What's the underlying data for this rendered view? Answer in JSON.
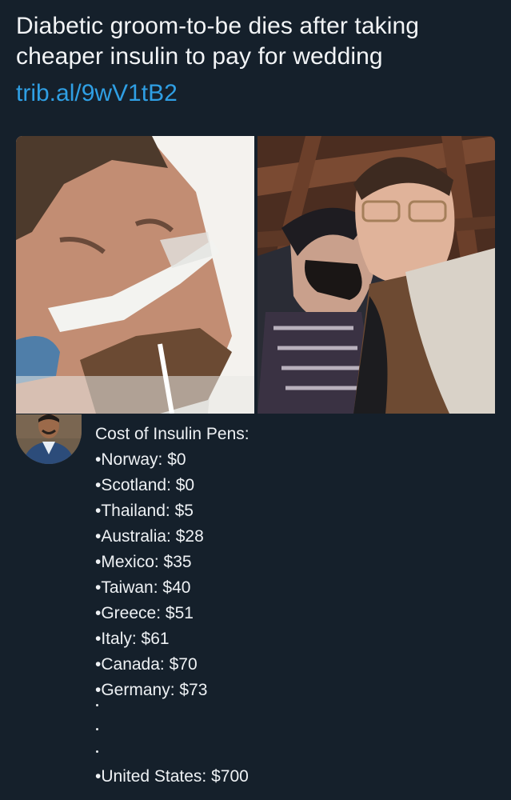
{
  "headline": {
    "line1": "Diabetic groom-to-be dies after taking",
    "line2": "cheaper insulin to pay for wedding"
  },
  "link": {
    "text": "trib.al/9wV1tB2"
  },
  "photos": {
    "left_description_icon": "hospital-photo",
    "right_description_icon": "couple-photo"
  },
  "reply": {
    "heading": "Cost of Insulin Pens:",
    "items": [
      "•Norway: $0",
      "•Scotland: $0",
      "•Thailand: $5",
      "•Australia: $28",
      "•Mexico: $35",
      "•Taiwan: $40",
      "•Greece: $51",
      "•Italy: $61",
      "•Canada: $70",
      "•Germany: $73"
    ],
    "final": "•United States: $700"
  },
  "colors": {
    "background": "#15202b",
    "link": "#2f9fe4",
    "text": "#eef1f4"
  }
}
